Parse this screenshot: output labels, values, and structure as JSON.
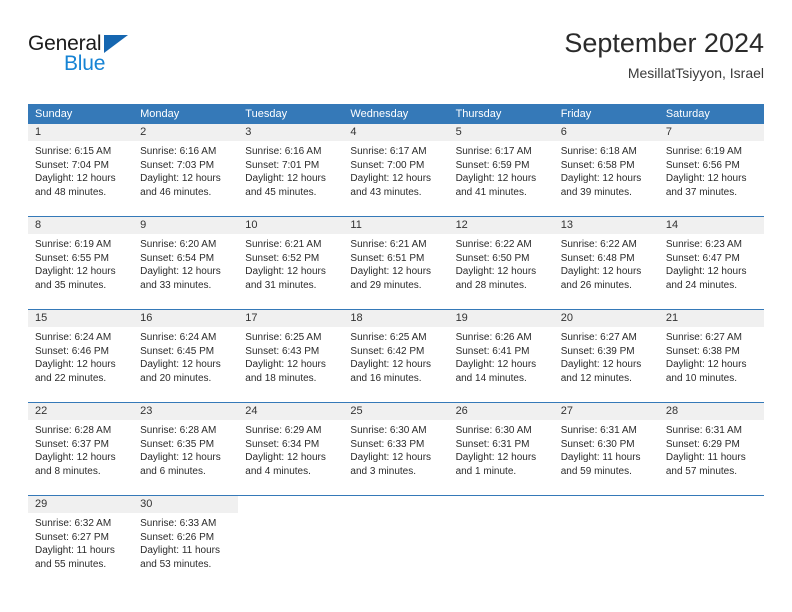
{
  "brand": {
    "line1": "General",
    "line2": "Blue",
    "triangle_icon": "brand-triangle-icon",
    "colors": {
      "dark": "#1a1a1a",
      "blue": "#1683d4",
      "triangle": "#1566b0"
    }
  },
  "header": {
    "title": "September 2024",
    "subtitle": "MesillatTsiyyon, Israel"
  },
  "theme": {
    "header_blue": "#3579b8",
    "day_band_gray": "#f0f0f0",
    "text": "#2b2b2b"
  },
  "calendar": {
    "weekdays": [
      "Sunday",
      "Monday",
      "Tuesday",
      "Wednesday",
      "Thursday",
      "Friday",
      "Saturday"
    ],
    "weeks": [
      [
        {
          "day": "1",
          "sunrise": "Sunrise: 6:15 AM",
          "sunset": "Sunset: 7:04 PM",
          "daylight1": "Daylight: 12 hours",
          "daylight2": "and 48 minutes."
        },
        {
          "day": "2",
          "sunrise": "Sunrise: 6:16 AM",
          "sunset": "Sunset: 7:03 PM",
          "daylight1": "Daylight: 12 hours",
          "daylight2": "and 46 minutes."
        },
        {
          "day": "3",
          "sunrise": "Sunrise: 6:16 AM",
          "sunset": "Sunset: 7:01 PM",
          "daylight1": "Daylight: 12 hours",
          "daylight2": "and 45 minutes."
        },
        {
          "day": "4",
          "sunrise": "Sunrise: 6:17 AM",
          "sunset": "Sunset: 7:00 PM",
          "daylight1": "Daylight: 12 hours",
          "daylight2": "and 43 minutes."
        },
        {
          "day": "5",
          "sunrise": "Sunrise: 6:17 AM",
          "sunset": "Sunset: 6:59 PM",
          "daylight1": "Daylight: 12 hours",
          "daylight2": "and 41 minutes."
        },
        {
          "day": "6",
          "sunrise": "Sunrise: 6:18 AM",
          "sunset": "Sunset: 6:58 PM",
          "daylight1": "Daylight: 12 hours",
          "daylight2": "and 39 minutes."
        },
        {
          "day": "7",
          "sunrise": "Sunrise: 6:19 AM",
          "sunset": "Sunset: 6:56 PM",
          "daylight1": "Daylight: 12 hours",
          "daylight2": "and 37 minutes."
        }
      ],
      [
        {
          "day": "8",
          "sunrise": "Sunrise: 6:19 AM",
          "sunset": "Sunset: 6:55 PM",
          "daylight1": "Daylight: 12 hours",
          "daylight2": "and 35 minutes."
        },
        {
          "day": "9",
          "sunrise": "Sunrise: 6:20 AM",
          "sunset": "Sunset: 6:54 PM",
          "daylight1": "Daylight: 12 hours",
          "daylight2": "and 33 minutes."
        },
        {
          "day": "10",
          "sunrise": "Sunrise: 6:21 AM",
          "sunset": "Sunset: 6:52 PM",
          "daylight1": "Daylight: 12 hours",
          "daylight2": "and 31 minutes."
        },
        {
          "day": "11",
          "sunrise": "Sunrise: 6:21 AM",
          "sunset": "Sunset: 6:51 PM",
          "daylight1": "Daylight: 12 hours",
          "daylight2": "and 29 minutes."
        },
        {
          "day": "12",
          "sunrise": "Sunrise: 6:22 AM",
          "sunset": "Sunset: 6:50 PM",
          "daylight1": "Daylight: 12 hours",
          "daylight2": "and 28 minutes."
        },
        {
          "day": "13",
          "sunrise": "Sunrise: 6:22 AM",
          "sunset": "Sunset: 6:48 PM",
          "daylight1": "Daylight: 12 hours",
          "daylight2": "and 26 minutes."
        },
        {
          "day": "14",
          "sunrise": "Sunrise: 6:23 AM",
          "sunset": "Sunset: 6:47 PM",
          "daylight1": "Daylight: 12 hours",
          "daylight2": "and 24 minutes."
        }
      ],
      [
        {
          "day": "15",
          "sunrise": "Sunrise: 6:24 AM",
          "sunset": "Sunset: 6:46 PM",
          "daylight1": "Daylight: 12 hours",
          "daylight2": "and 22 minutes."
        },
        {
          "day": "16",
          "sunrise": "Sunrise: 6:24 AM",
          "sunset": "Sunset: 6:45 PM",
          "daylight1": "Daylight: 12 hours",
          "daylight2": "and 20 minutes."
        },
        {
          "day": "17",
          "sunrise": "Sunrise: 6:25 AM",
          "sunset": "Sunset: 6:43 PM",
          "daylight1": "Daylight: 12 hours",
          "daylight2": "and 18 minutes."
        },
        {
          "day": "18",
          "sunrise": "Sunrise: 6:25 AM",
          "sunset": "Sunset: 6:42 PM",
          "daylight1": "Daylight: 12 hours",
          "daylight2": "and 16 minutes."
        },
        {
          "day": "19",
          "sunrise": "Sunrise: 6:26 AM",
          "sunset": "Sunset: 6:41 PM",
          "daylight1": "Daylight: 12 hours",
          "daylight2": "and 14 minutes."
        },
        {
          "day": "20",
          "sunrise": "Sunrise: 6:27 AM",
          "sunset": "Sunset: 6:39 PM",
          "daylight1": "Daylight: 12 hours",
          "daylight2": "and 12 minutes."
        },
        {
          "day": "21",
          "sunrise": "Sunrise: 6:27 AM",
          "sunset": "Sunset: 6:38 PM",
          "daylight1": "Daylight: 12 hours",
          "daylight2": "and 10 minutes."
        }
      ],
      [
        {
          "day": "22",
          "sunrise": "Sunrise: 6:28 AM",
          "sunset": "Sunset: 6:37 PM",
          "daylight1": "Daylight: 12 hours",
          "daylight2": "and 8 minutes."
        },
        {
          "day": "23",
          "sunrise": "Sunrise: 6:28 AM",
          "sunset": "Sunset: 6:35 PM",
          "daylight1": "Daylight: 12 hours",
          "daylight2": "and 6 minutes."
        },
        {
          "day": "24",
          "sunrise": "Sunrise: 6:29 AM",
          "sunset": "Sunset: 6:34 PM",
          "daylight1": "Daylight: 12 hours",
          "daylight2": "and 4 minutes."
        },
        {
          "day": "25",
          "sunrise": "Sunrise: 6:30 AM",
          "sunset": "Sunset: 6:33 PM",
          "daylight1": "Daylight: 12 hours",
          "daylight2": "and 3 minutes."
        },
        {
          "day": "26",
          "sunrise": "Sunrise: 6:30 AM",
          "sunset": "Sunset: 6:31 PM",
          "daylight1": "Daylight: 12 hours",
          "daylight2": "and 1 minute."
        },
        {
          "day": "27",
          "sunrise": "Sunrise: 6:31 AM",
          "sunset": "Sunset: 6:30 PM",
          "daylight1": "Daylight: 11 hours",
          "daylight2": "and 59 minutes."
        },
        {
          "day": "28",
          "sunrise": "Sunrise: 6:31 AM",
          "sunset": "Sunset: 6:29 PM",
          "daylight1": "Daylight: 11 hours",
          "daylight2": "and 57 minutes."
        }
      ],
      [
        {
          "day": "29",
          "sunrise": "Sunrise: 6:32 AM",
          "sunset": "Sunset: 6:27 PM",
          "daylight1": "Daylight: 11 hours",
          "daylight2": "and 55 minutes."
        },
        {
          "day": "30",
          "sunrise": "Sunrise: 6:33 AM",
          "sunset": "Sunset: 6:26 PM",
          "daylight1": "Daylight: 11 hours",
          "daylight2": "and 53 minutes."
        },
        {
          "day": "",
          "sunrise": "",
          "sunset": "",
          "daylight1": "",
          "daylight2": ""
        },
        {
          "day": "",
          "sunrise": "",
          "sunset": "",
          "daylight1": "",
          "daylight2": ""
        },
        {
          "day": "",
          "sunrise": "",
          "sunset": "",
          "daylight1": "",
          "daylight2": ""
        },
        {
          "day": "",
          "sunrise": "",
          "sunset": "",
          "daylight1": "",
          "daylight2": ""
        },
        {
          "day": "",
          "sunrise": "",
          "sunset": "",
          "daylight1": "",
          "daylight2": ""
        }
      ]
    ]
  }
}
